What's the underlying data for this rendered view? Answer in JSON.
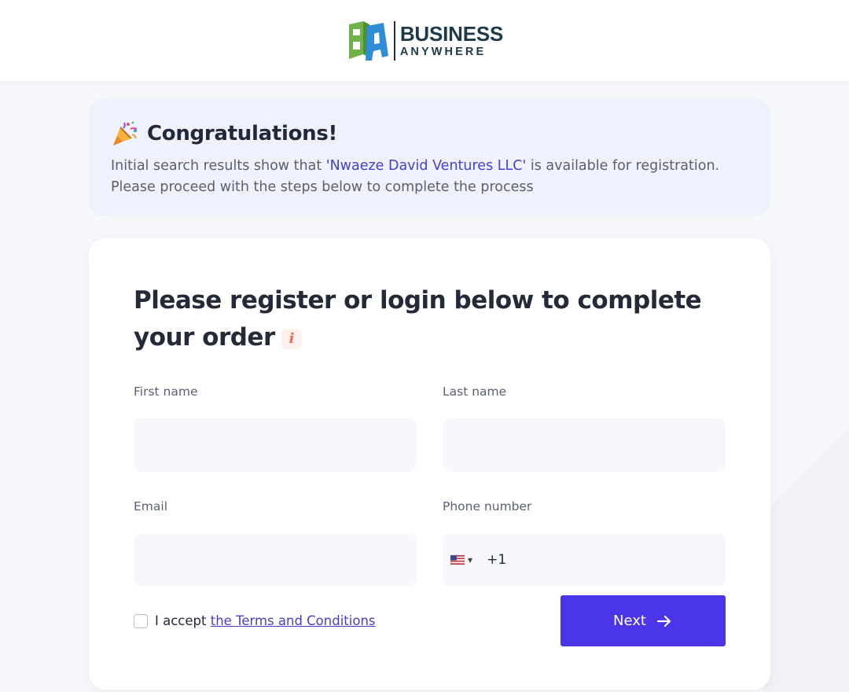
{
  "header": {
    "logo_word1": "BUSINESS",
    "logo_word2": "ANYWHERE"
  },
  "banner": {
    "title": "Congratulations!",
    "text_before": "Initial search results show that ",
    "company": "'Nwaeze David Ventures LLC'",
    "text_after": " is available for registration. Please proceed with the steps below to complete the process",
    "icon": "party-popper-icon"
  },
  "form": {
    "title": "Please register or login below to complete your order",
    "first_name_label": "First name",
    "last_name_label": "Last name",
    "email_label": "Email",
    "phone_label": "Phone number",
    "first_name_value": "",
    "last_name_value": "",
    "email_value": "",
    "phone_country_code": "+1",
    "phone_flag": "us-flag-icon",
    "terms_prefix": "I accept ",
    "terms_link": "the Terms and Conditions",
    "terms_checked": false,
    "next_label": "Next"
  },
  "colors": {
    "accent": "#4a35e8",
    "link": "#4a3ec8",
    "banner_bg": "#eef2fd",
    "info_icon": "#ef6a4f"
  }
}
